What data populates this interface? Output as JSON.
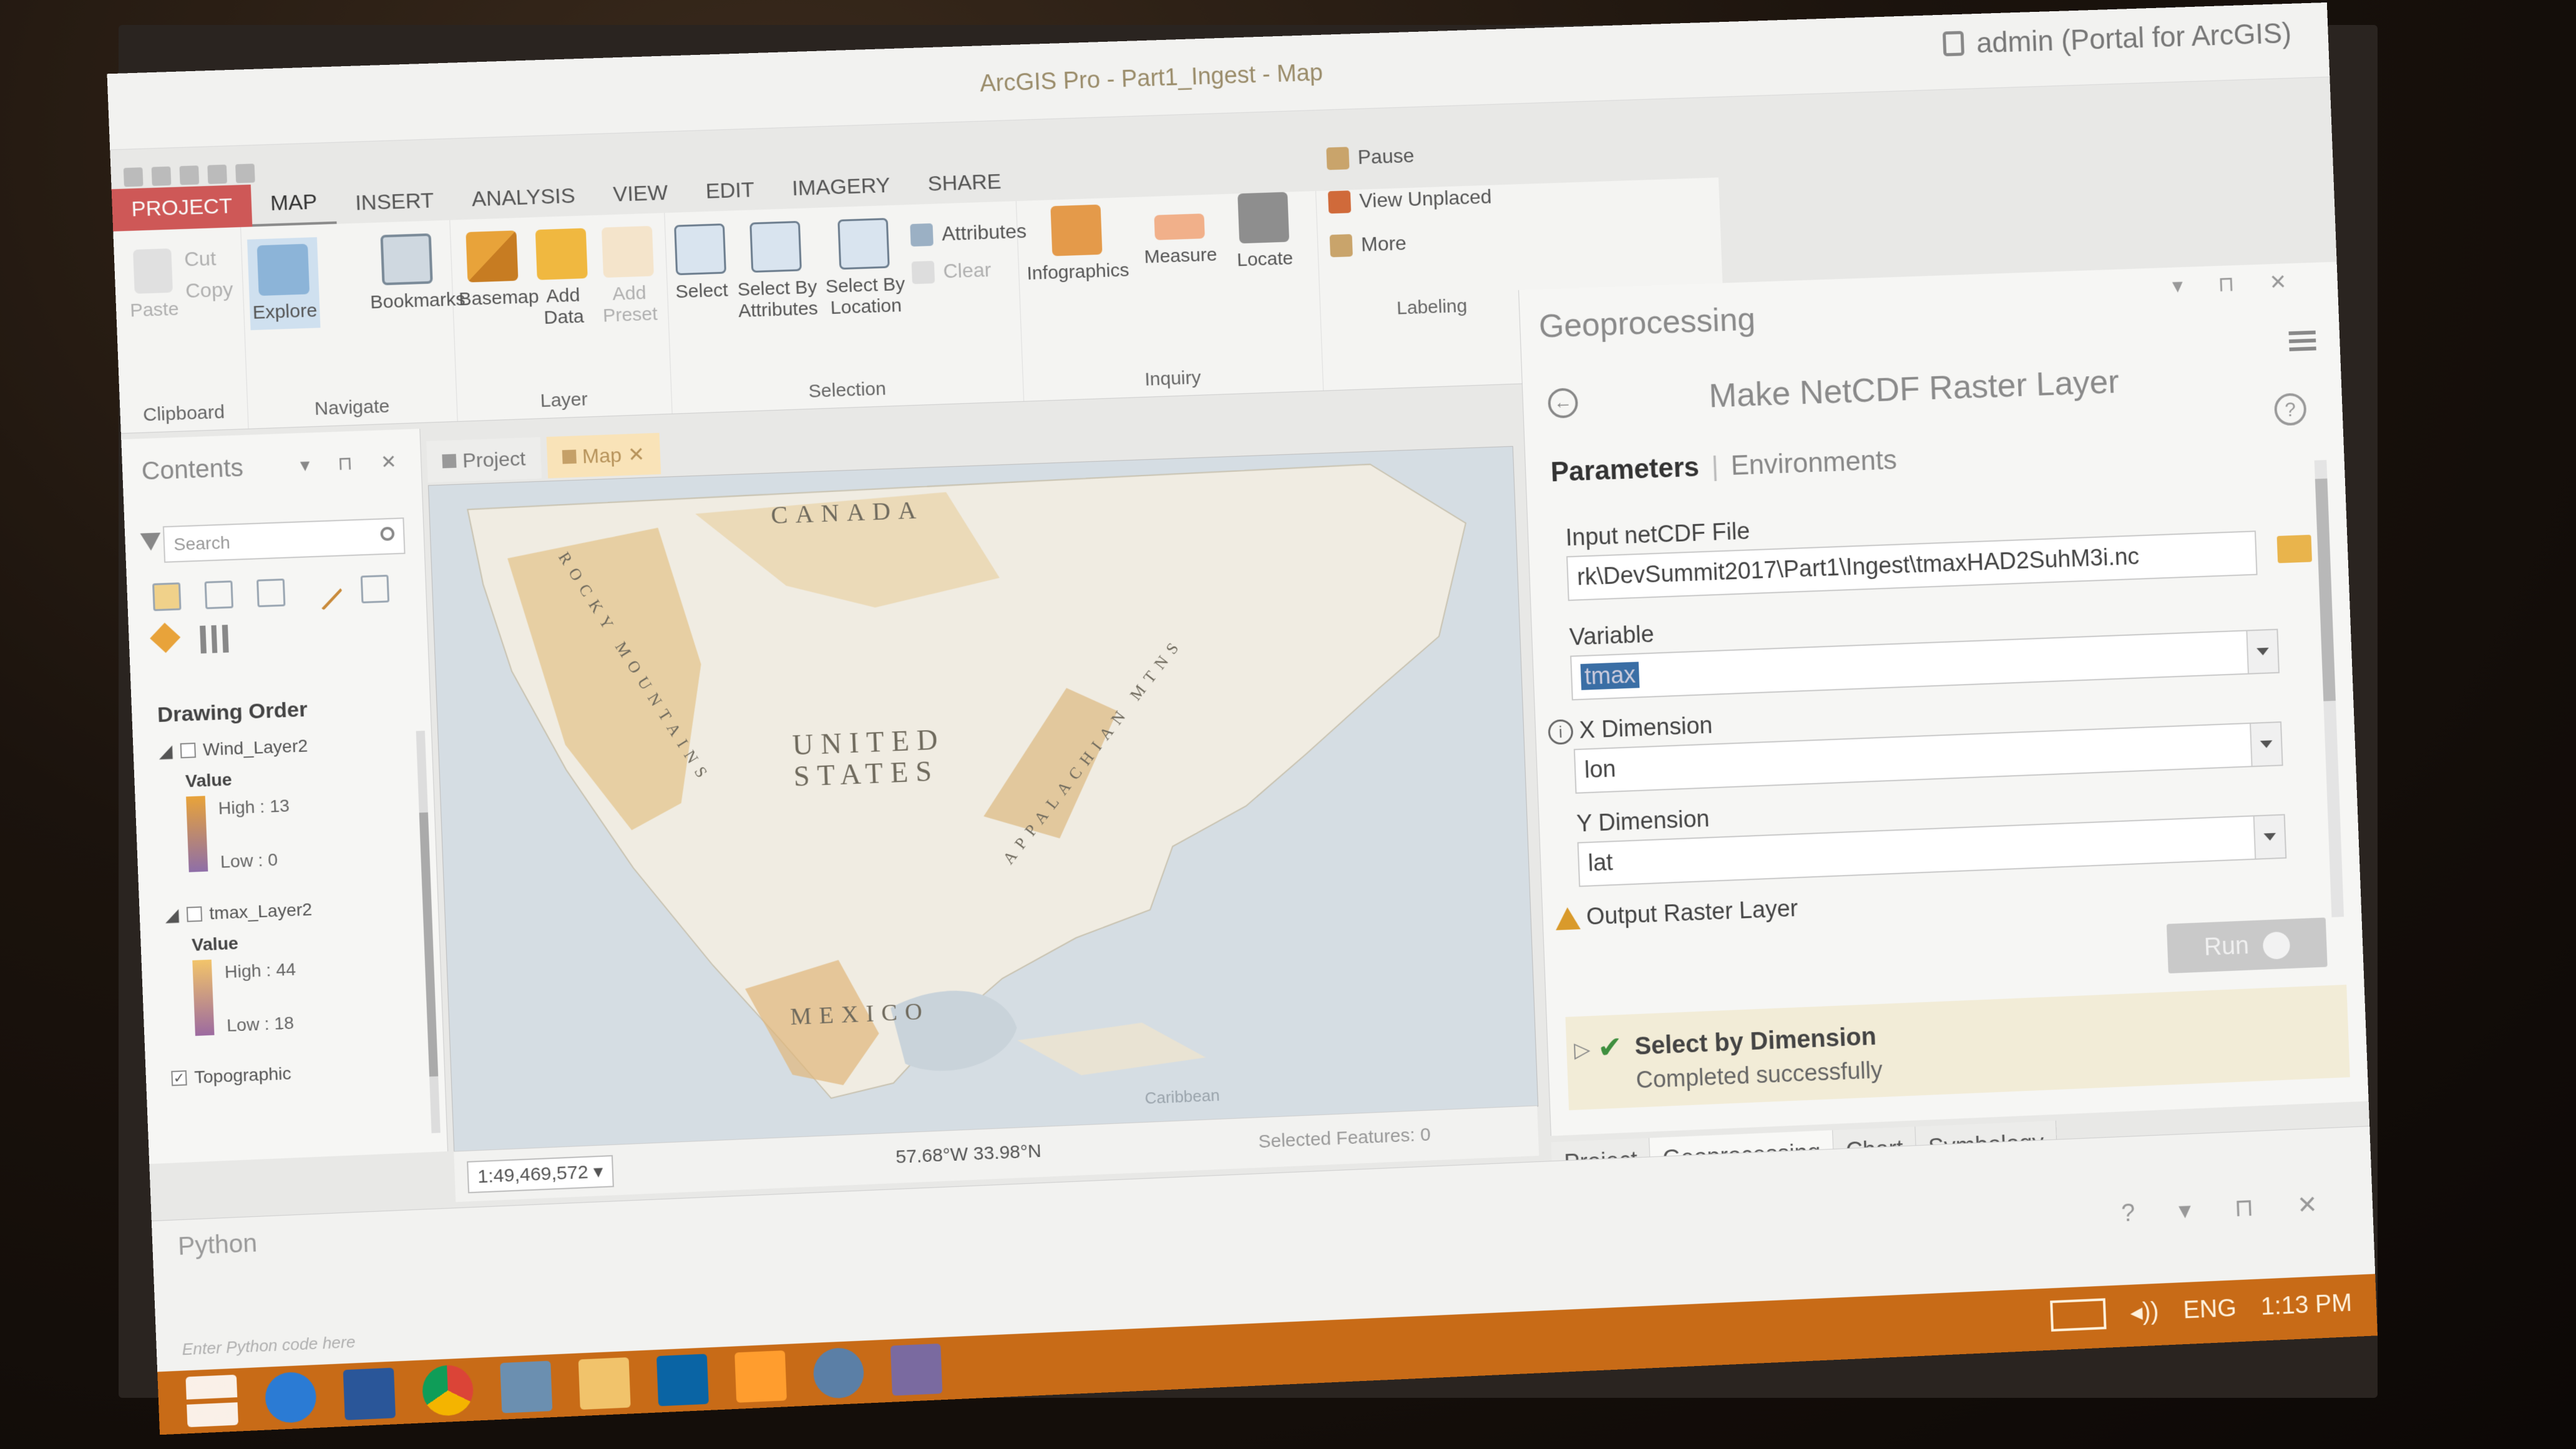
{
  "app": {
    "title": "ArcGIS Pro - Part1_Ingest - Map",
    "signin": "admin (Portal for ArcGIS)"
  },
  "ribbon": {
    "tabs": [
      "PROJECT",
      "MAP",
      "INSERT",
      "ANALYSIS",
      "VIEW",
      "EDIT",
      "IMAGERY",
      "SHARE"
    ],
    "active_tab": "MAP",
    "clipboard": {
      "paste": "Paste",
      "cut": "Cut",
      "copy": "Copy",
      "label": "Clipboard"
    },
    "navigate": {
      "explore": "Explore",
      "bookmarks": "Bookmarks",
      "label": "Navigate"
    },
    "layer": {
      "basemap": "Basemap",
      "add_data": "Add Data",
      "add_preset": "Add Preset",
      "label": "Layer"
    },
    "selection": {
      "select": "Select",
      "select_by_attributes": "Select By Attributes",
      "select_by_location": "Select By Location",
      "attributes": "Attributes",
      "clear": "Clear",
      "label": "Selection"
    },
    "inquiry": {
      "infographics": "Infographics",
      "measure": "Measure",
      "locate": "Locate",
      "label": "Inquiry"
    },
    "labeling": {
      "pause": "Pause",
      "view_unplaced": "View Unplaced",
      "more": "More",
      "label": "Labeling"
    }
  },
  "contents": {
    "title": "Contents",
    "search_placeholder": "Search",
    "drawing_order": "Drawing Order",
    "layers": [
      {
        "name": "Wind_Layer2",
        "value_label": "Value",
        "high": "High : 13",
        "low": "Low : 0",
        "checked": false
      },
      {
        "name": "tmax_Layer2",
        "value_label": "Value",
        "high": "High : 44",
        "low": "Low : 18",
        "checked": false
      },
      {
        "name": "Topographic",
        "checked": true
      }
    ]
  },
  "doc_tabs": [
    "Project",
    "Map"
  ],
  "map": {
    "labels": {
      "canada": "CANADA",
      "us_line1": "UNITED",
      "us_line2": "STATES",
      "mexico": "MEXICO",
      "rocky": "ROCKY MOUNTAINS",
      "appalachian": "APPALACHIAN MTNS",
      "caribbean": "Caribbean"
    }
  },
  "status": {
    "scale": "1:49,469,572",
    "coords": "57.68°W 33.98°N",
    "selected_features": "Selected Features: 0"
  },
  "geoprocessing": {
    "title": "Geoprocessing",
    "tool": "Make NetCDF Raster Layer",
    "tab_parameters": "Parameters",
    "tab_environments": "Environments",
    "params": {
      "input_label": "Input netCDF File",
      "input_value": "rk\\DevSummit2017\\Part1\\Ingest\\tmaxHAD2SuhM3i.nc",
      "variable_label": "Variable",
      "variable_value": "tmax",
      "x_label": "X Dimension",
      "x_value": "lon",
      "y_label": "Y Dimension",
      "y_value": "lat",
      "output_label": "Output Raster Layer"
    },
    "run": "Run",
    "result_title": "Select by Dimension",
    "result_status": "Completed successfully"
  },
  "bottom_tabs": [
    "Project",
    "Geoprocessing",
    "Chart",
    "Symbology"
  ],
  "python": {
    "title": "Python",
    "placeholder": "Enter Python code here"
  },
  "taskbar": {
    "lang": "ENG",
    "time": "1:13 PM"
  },
  "colors": {
    "taskbar": "#c86b17",
    "project_tab": "#c62828",
    "map_tab_active": "#f9e3b8",
    "result_bg": "#f2ecd7"
  }
}
